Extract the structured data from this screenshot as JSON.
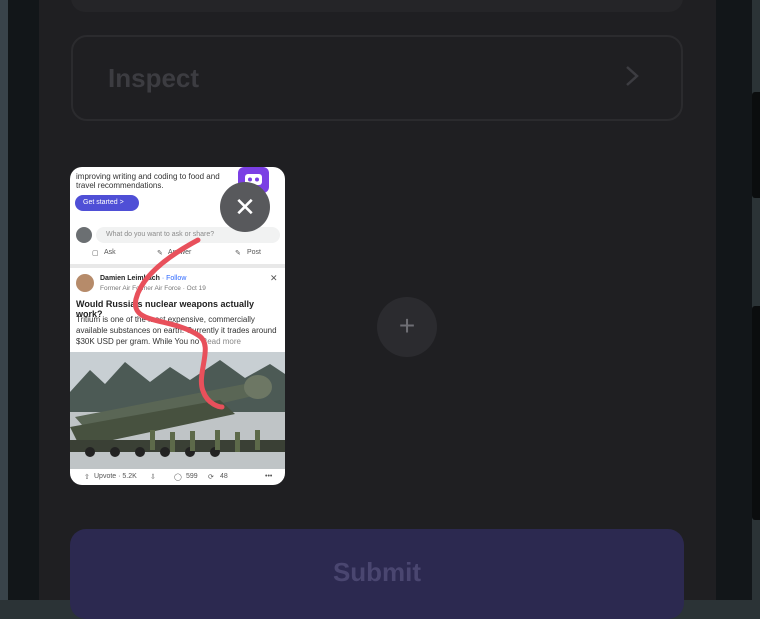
{
  "inspect": {
    "label": "Inspect",
    "chevron_icon": "chevron-right-icon"
  },
  "thumbnail": {
    "promo_line1": "improving writing and coding to food and",
    "promo_line2": "travel recommendations.",
    "get_started": "Get started  >",
    "ask_placeholder": "What do you want to ask or share?",
    "actions": {
      "ask": "Ask",
      "answer": "Answer",
      "post": "Post"
    },
    "author": {
      "name": "Damien Leimbach",
      "follow": " · Follow",
      "credential": "Former Air Former Air Force · Oct 19"
    },
    "question_title": "Would Russia's nuclear weapons actually work?",
    "question_body": "Tritium is one of the most expensive, commercially available substances on earth. Currently it trades around $30K USD per gram. While You no",
    "read_more": "Read more",
    "footer": {
      "upvote": "Upvote · 5.2K",
      "comments": "599",
      "shares": "48",
      "more": "•••"
    },
    "close_symbol": "✕"
  },
  "add_button": {
    "symbol": "+"
  },
  "submit": {
    "label": "Submit"
  },
  "colors": {
    "background": "#1f1f22",
    "submit_bg": "#2c2950",
    "scribble": "#e8505b",
    "bot_icon": "#7b3fe4"
  }
}
